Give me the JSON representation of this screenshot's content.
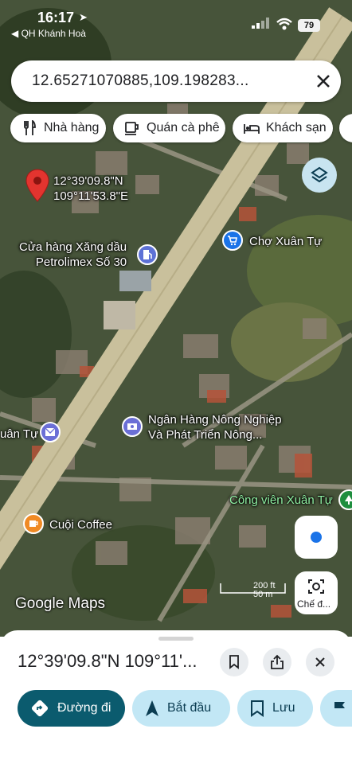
{
  "status_bar": {
    "time": "16:17",
    "back_label": "◀ QH Khánh Hoà",
    "battery": "79"
  },
  "search": {
    "query": "12.65271070885,109.198283..."
  },
  "chips": [
    {
      "label": "Nhà hàng",
      "icon": "fork-knife-icon"
    },
    {
      "label": "Quán cà phê",
      "icon": "coffee-cup-icon"
    },
    {
      "label": "Khách sạn",
      "icon": "bed-icon"
    }
  ],
  "map": {
    "pin_label_lat": "12°39'09.8\"N",
    "pin_label_lng": "109°11'53.8\"E",
    "places": {
      "gas_station": "Cửa hàng Xăng dầu\nPetrolimex Số 30",
      "market": "Chợ Xuân Tự",
      "bank": "Ngân Hàng Nông Nghiệp\nVà Phát Triển Nông...",
      "post": "uân Tự",
      "park": "Công viên Xuân Tự",
      "cafe": "Cuội Coffee"
    },
    "logo": "Google Maps",
    "scale_label": "200 ft\n50 m",
    "lens_label": "Chế đ...",
    "colors": {
      "pin": "#e3342f",
      "market_poi": "#1a73e8",
      "bank_poi": "#6b6fd6",
      "cafe_poi": "#f08a24",
      "park_poi": "#1e8e3e"
    }
  },
  "sheet": {
    "title": "12°39'09.8\"N 109°11'...",
    "actions": [
      {
        "label": "Đường đi",
        "icon": "directions-icon"
      },
      {
        "label": "Bắt đầu",
        "icon": "navigation-arrow-icon"
      },
      {
        "label": "Lưu",
        "icon": "bookmark-icon"
      }
    ]
  }
}
